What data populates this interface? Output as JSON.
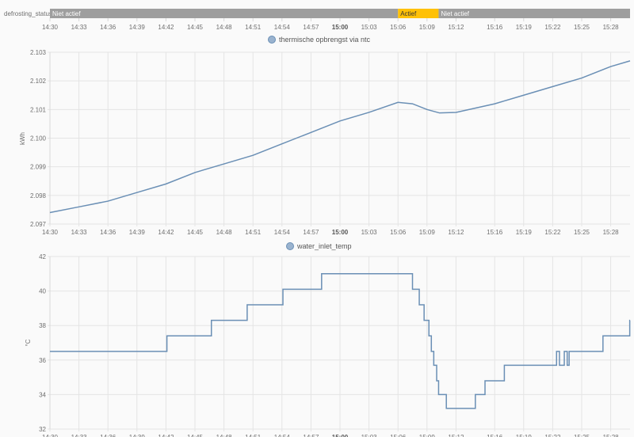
{
  "timeline": {
    "entity_label": "defrosting_status",
    "segments": [
      {
        "label": "Niet actief",
        "start_min": 0,
        "end_min": 36,
        "color": "#9e9e9e"
      },
      {
        "label": "Actief",
        "start_min": 36,
        "end_min": 40.2,
        "color": "#ffc107"
      },
      {
        "label": "Niet actief",
        "start_min": 40.2,
        "end_min": 60,
        "color": "#9e9e9e"
      }
    ]
  },
  "x_ticks": [
    {
      "label": "14:30",
      "min": 0
    },
    {
      "label": "14:33",
      "min": 3
    },
    {
      "label": "14:36",
      "min": 6
    },
    {
      "label": "14:39",
      "min": 9
    },
    {
      "label": "14:42",
      "min": 12
    },
    {
      "label": "14:45",
      "min": 15
    },
    {
      "label": "14:48",
      "min": 18
    },
    {
      "label": "14:51",
      "min": 21
    },
    {
      "label": "14:54",
      "min": 24
    },
    {
      "label": "14:57",
      "min": 27
    },
    {
      "label": "15:00",
      "min": 30,
      "bold": true
    },
    {
      "label": "15:03",
      "min": 33
    },
    {
      "label": "15:06",
      "min": 36
    },
    {
      "label": "15:09",
      "min": 39
    },
    {
      "label": "15:12",
      "min": 42
    },
    {
      "label": "15:16",
      "min": 46
    },
    {
      "label": "15:19",
      "min": 49
    },
    {
      "label": "15:22",
      "min": 52
    },
    {
      "label": "15:25",
      "min": 55
    },
    {
      "label": "15:28",
      "min": 58
    }
  ],
  "chart_data": [
    {
      "type": "line",
      "title": "",
      "legend": "thermische opbrengst via ntc",
      "legend_position": "top-center",
      "ylabel": "kWh",
      "xlabel": "",
      "xlim_min": [
        0,
        60
      ],
      "ylim": [
        2.097,
        2.103
      ],
      "y_ticks": [
        "2.103",
        "2.102",
        "2.101",
        "2.100",
        "2.099",
        "2.098",
        "2.097"
      ],
      "color": "#6a8fb5",
      "x_min": [
        0,
        3,
        6,
        9,
        12,
        15,
        18,
        21,
        24,
        27,
        30,
        33,
        36,
        37.5,
        39,
        40.3,
        42,
        46,
        49,
        52,
        55,
        58,
        60
      ],
      "y": [
        2.0974,
        2.0976,
        2.0978,
        2.0981,
        2.0984,
        2.0988,
        2.0991,
        2.0994,
        2.0998,
        2.1002,
        2.1006,
        2.1009,
        2.10125,
        2.1012,
        2.101,
        2.10088,
        2.1009,
        2.1012,
        2.1015,
        2.1018,
        2.1021,
        2.1025,
        2.1027
      ],
      "grid": true
    },
    {
      "type": "line",
      "step": true,
      "title": "",
      "legend": "water_inlet_temp",
      "legend_position": "top-center",
      "ylabel": "°C",
      "xlabel": "",
      "xlim_min": [
        0,
        60
      ],
      "ylim": [
        32,
        42
      ],
      "y_ticks": [
        "42",
        "40",
        "38",
        "36",
        "34",
        "32"
      ],
      "color": "#6a8fb5",
      "x_min": [
        0,
        12.1,
        16.7,
        20.4,
        24.1,
        28.1,
        37.5,
        38.2,
        38.7,
        39.2,
        39.45,
        39.7,
        40.0,
        40.2,
        41.0,
        44.0,
        45.0,
        47.0,
        52.4,
        52.7,
        53.2,
        53.5,
        53.7,
        57.2,
        59.97
      ],
      "y": [
        36.5,
        37.4,
        38.3,
        39.2,
        40.1,
        41.0,
        40.1,
        39.2,
        38.3,
        37.4,
        36.5,
        35.7,
        34.8,
        34.0,
        33.2,
        34.0,
        34.8,
        35.7,
        36.5,
        35.7,
        36.5,
        35.7,
        36.5,
        37.4,
        38.3
      ],
      "grid": true
    }
  ]
}
